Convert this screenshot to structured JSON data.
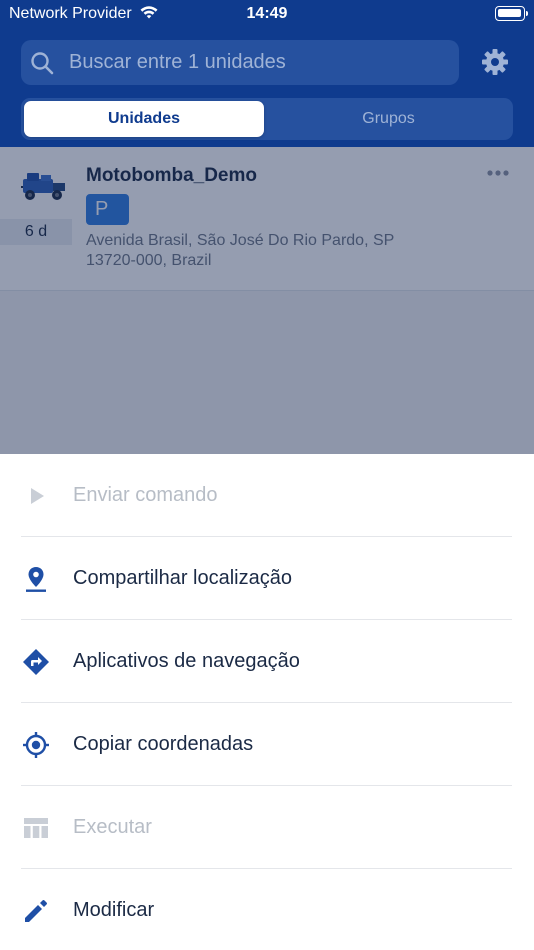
{
  "status_bar": {
    "carrier": "Network Provider",
    "time": "14:49"
  },
  "search": {
    "placeholder": "Buscar entre 1 unidades"
  },
  "tabs": [
    {
      "label": "Unidades",
      "active": true
    },
    {
      "label": "Grupos",
      "active": false
    }
  ],
  "unit": {
    "name": "Motobomba_Demo",
    "age": "6 d",
    "status_badge": "P",
    "address_line1": "Avenida Brasil, São José Do Rio Pardo, SP",
    "address_line2": "13720-000, Brazil",
    "icon": "pump-truck-image"
  },
  "actions": [
    {
      "label": "Enviar comando",
      "icon": "play-icon",
      "enabled": false
    },
    {
      "label": "Compartilhar localização",
      "icon": "location-pin-icon",
      "enabled": true
    },
    {
      "label": "Aplicativos de navegação",
      "icon": "directions-icon",
      "enabled": true
    },
    {
      "label": "Copiar coordenadas",
      "icon": "crosshair-icon",
      "enabled": true
    },
    {
      "label": "Executar",
      "icon": "table-icon",
      "enabled": false
    },
    {
      "label": "Modificar",
      "icon": "pencil-icon",
      "enabled": true
    }
  ],
  "colors": {
    "header": "#0f3b8e",
    "accent": "#1f4fa6",
    "badge": "#2f7de0",
    "disabled": "#b7bdc6"
  }
}
